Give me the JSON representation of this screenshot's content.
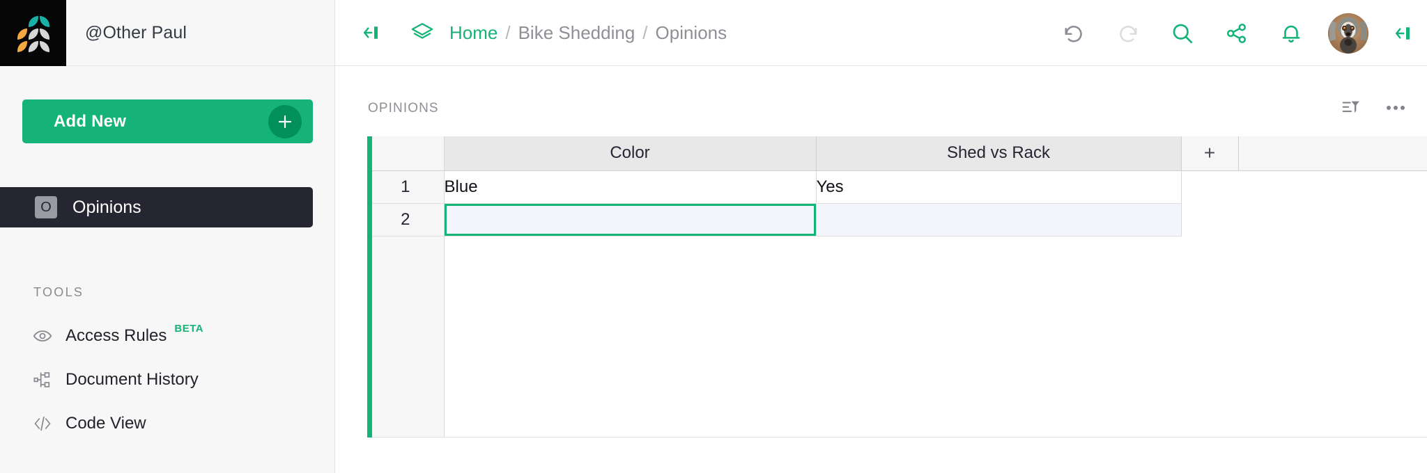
{
  "app": {
    "org_name": "@Other Paul",
    "logo_colors": {
      "teal": "#19b0a8",
      "orange": "#f5a742",
      "grey": "#d6d6d6"
    },
    "accent": "#16b378"
  },
  "sidebar": {
    "add_new_label": "Add New",
    "add_new_icon": "plus-icon",
    "page_item": {
      "badge": "O",
      "label": "Opinions"
    },
    "tools_header": "TOOLS",
    "tools": [
      {
        "label": "Access Rules",
        "icon": "eye-icon",
        "badge": "BETA"
      },
      {
        "label": "Document History",
        "icon": "branch-icon",
        "badge": ""
      },
      {
        "label": "Code View",
        "icon": "code-icon",
        "badge": ""
      }
    ]
  },
  "topbar": {
    "collapse_left_icon": "collapse-left-icon",
    "doc_icon": "layers-icon",
    "breadcrumb": {
      "home": "Home",
      "separator": "/",
      "doc": "Bike Shedding",
      "page": "Opinions"
    },
    "actions": [
      {
        "name": "undo",
        "icon": "undo-icon",
        "state": "enabled"
      },
      {
        "name": "redo",
        "icon": "redo-icon",
        "state": "disabled"
      },
      {
        "name": "search",
        "icon": "search-icon",
        "state": "enabled"
      },
      {
        "name": "share",
        "icon": "share-icon",
        "state": "enabled"
      },
      {
        "name": "notifications",
        "icon": "bell-icon",
        "state": "enabled"
      }
    ],
    "avatar_alt": "user-avatar",
    "collapse_right_icon": "collapse-right-icon"
  },
  "section": {
    "title": "OPINIONS",
    "sort_filter_icon": "sort-filter-icon",
    "more_icon": "ellipsis-icon"
  },
  "grid": {
    "columns": [
      "Color",
      "Shed vs Rack"
    ],
    "add_column_label": "+",
    "rows": [
      {
        "num": "1",
        "Color": "Blue",
        "Shed vs Rack": "Yes"
      },
      {
        "num": "2",
        "Color": "",
        "Shed vs Rack": ""
      }
    ],
    "selected_cell": {
      "row": "2",
      "column": "Color"
    }
  }
}
